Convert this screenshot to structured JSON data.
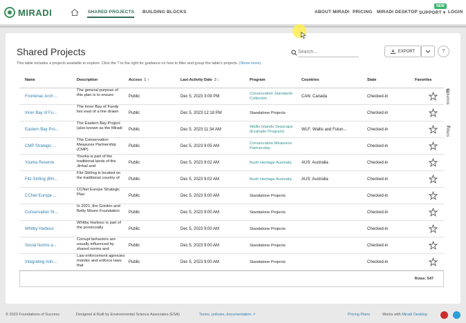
{
  "app": {
    "logo_text": "MIRADI"
  },
  "nav": {
    "shared_projects": "SHARED PROJECTS",
    "building_blocks": "BUILDING BLOCKS",
    "about": "ABOUT MIRADI",
    "pricing": "PRICING",
    "desktop": "MIRADI DESKTOP",
    "support": "SUPPORT",
    "login": "LOGIN",
    "new_badge": "NEW"
  },
  "page": {
    "title": "Shared Projects",
    "subtitle": "This table includes a projects available to explore. Click the ? to the right for guidance on how to filter and group the table's projects.",
    "show_more": "(Show more)"
  },
  "toolbar": {
    "search_placeholder": "Search...",
    "export_label": "EXPORT",
    "help_label": "?"
  },
  "table": {
    "columns": {
      "name": "Name",
      "description": "Description",
      "access": "Access",
      "access_sort": "1",
      "last_activity": "Last Activity Date",
      "last_activity_sort": "2",
      "program": "Program",
      "countries": "Countries",
      "state": "State",
      "favorites": "Favorites"
    },
    "rows": [
      {
        "name": "Frontenac Arch ...",
        "description": "The general purpose of this plan is to ensure",
        "access": "Public",
        "date": "Dec 5, 2023 3:09 PM",
        "program": "Conservation Standards Collective",
        "program_link": true,
        "countries": "CAN: Canada",
        "state": "Checked-in"
      },
      {
        "name": "Inner Bay of Fu...",
        "description": "The Inner Bay of Fundy lies east of a line drawn",
        "access": "Public",
        "date": "Dec 5, 2023 12:18 PM",
        "program": "Standalone Projects",
        "program_link": false,
        "countries": "",
        "state": "Checked-in"
      },
      {
        "name": "Eastern Bay Pro...",
        "description": "The Eastern Bay Project (also known as the Miradi",
        "access": "Public",
        "date": "Dec 5, 2023 11:34 AM",
        "program": "Wallis Islands Seascape (Example Program)",
        "program_link": true,
        "countries": "WLF: Wallis and Futun...",
        "state": "Checked-in"
      },
      {
        "name": "CMP Strategic ...",
        "description": "The Conservation Measures Partnership (CMP)",
        "access": "Public",
        "date": "Dec 5, 2023 9:05 AM",
        "program": "Conservation Measures Partnership",
        "program_link": true,
        "countries": "",
        "state": "Checked-in"
      },
      {
        "name": "Yourka Reserve",
        "description": "Yourka is part of the traditional lands of the Jirrbal and",
        "access": "Public",
        "date": "Dec 5, 2023 9:02 AM",
        "program": "Bush Heritage Australia",
        "program_link": true,
        "countries": "AUS: Australia",
        "state": "Checked-in"
      },
      {
        "name": "Fitz-Stirling (BH...",
        "description": "Fitz-Stirling is located on the traditional country of",
        "access": "Public",
        "date": "Dec 5, 2023 9:02 AM",
        "program": "Bush Heritage Australia",
        "program_link": true,
        "countries": "AUS: Australia",
        "state": "Checked-in"
      },
      {
        "name": "CCNet Europe ...",
        "description": "CCNet Europe Strategic Plan",
        "access": "Public",
        "date": "Dec 5, 2023 9:00 AM",
        "program": "Standalone Projects",
        "program_link": false,
        "countries": "",
        "state": "Checked-in"
      },
      {
        "name": "Conservation St...",
        "description": "In 2021, the Gordon and Betty Moore Foundation",
        "access": "Public",
        "date": "Dec 5, 2023 9:00 AM",
        "program": "Standalone Projects",
        "program_link": false,
        "countries": "",
        "state": "Checked-in"
      },
      {
        "name": "Whitby Harbour",
        "description": "Whitby Harbour is part of the provincially",
        "access": "Public",
        "date": "Dec 5, 2023 9:00 AM",
        "program": "Standalone Projects",
        "program_link": false,
        "countries": "",
        "state": "Checked-in"
      },
      {
        "name": "Social Norms a...",
        "description": "Corrupt behaviors are usually influenced by shared norms and",
        "access": "Public",
        "date": "Dec 5, 2023 9:00 AM",
        "program": "Standalone Projects",
        "program_link": false,
        "countries": "",
        "state": "Checked-in"
      },
      {
        "name": "Integrating Anti-...",
        "description": "Law enforcement agencies monitor and enforce laws that",
        "access": "Public",
        "date": "Dec 5, 2023 9:00 AM",
        "program": "Standalone Projects",
        "program_link": false,
        "countries": "",
        "state": "Checked-in"
      }
    ],
    "rows_count": "Rows: 547"
  },
  "side_tabs": {
    "columns": "Columns",
    "filters": "Filters"
  },
  "footer": {
    "copyright": "© 2023 Foundations of Success",
    "designed": "Designed & Built by Environmental Science Associates (ESA)",
    "terms": "Terms, policies, documentation",
    "pricing": "Pricing Plans",
    "works_with": "Works with",
    "works_with_link": "Miradi Desktop"
  },
  "colors": {
    "brand": "#2f7a50",
    "link": "#2f7eb0",
    "highlight": "#fff050"
  }
}
